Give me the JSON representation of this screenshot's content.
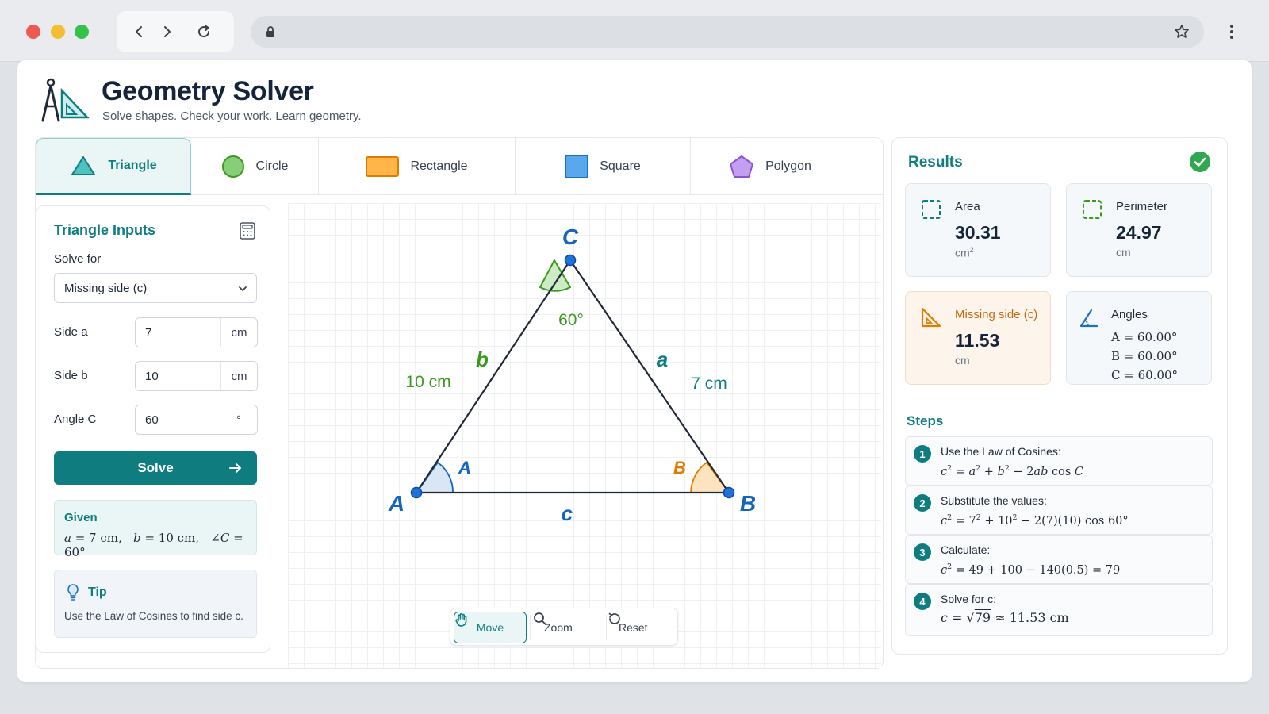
{
  "app": {
    "title": "Geometry Solver",
    "subtitle": "Solve shapes. Check your work. Learn geometry."
  },
  "tabs": [
    {
      "label": "Triangle",
      "icon": "triangle-icon",
      "active": true
    },
    {
      "label": "Circle",
      "icon": "circle-icon",
      "active": false
    },
    {
      "label": "Rectangle",
      "icon": "rectangle-icon",
      "active": false
    },
    {
      "label": "Square",
      "icon": "square-icon",
      "active": false
    },
    {
      "label": "Polygon",
      "icon": "pentagon-icon",
      "active": false
    }
  ],
  "inputs": {
    "title": "Triangle Inputs",
    "solve_for_label": "Solve for",
    "solve_for_value": "Missing side (c)",
    "side_a": {
      "label": "Side a",
      "value": "7",
      "unit": "cm"
    },
    "side_b": {
      "label": "Side b",
      "value": "10",
      "unit": "cm"
    },
    "angle_c": {
      "label": "Angle C",
      "value": "60",
      "unit": "°"
    },
    "solve_button": "Solve",
    "given_title": "Given",
    "tip_title": "Tip",
    "tip_text": "Use the Law of Cosines to find side c."
  },
  "diagram": {
    "vertex_a": "A",
    "vertex_b": "B",
    "vertex_c": "C",
    "side_a_name": "a",
    "side_b_name": "b",
    "side_c_name": "c",
    "side_a_length": "7 cm",
    "side_b_length": "10 cm",
    "angle_c_value": "60°",
    "angle_a_name": "A",
    "angle_b_name": "B"
  },
  "toolbar": {
    "move": "Move",
    "zoom": "Zoom",
    "reset": "Reset"
  },
  "results": {
    "title": "Results",
    "area": {
      "label": "Area",
      "value": "30.31",
      "unit": "cm"
    },
    "perimeter": {
      "label": "Perimeter",
      "value": "24.97",
      "unit": "cm"
    },
    "missing_side": {
      "label": "Missing side (c)",
      "value": "11.53",
      "unit": "cm"
    },
    "angles": {
      "label": "Angles",
      "a": "A = 60.00°",
      "b": "B = 60.00°",
      "c": "C = 60.00°"
    }
  },
  "steps": {
    "title": "Steps",
    "items": [
      {
        "num": "1",
        "label": "Use the Law of Cosines:"
      },
      {
        "num": "2",
        "label": "Substitute the values:"
      },
      {
        "num": "3",
        "label": "Calculate:"
      },
      {
        "num": "4",
        "label": "Solve for c:"
      }
    ]
  },
  "colors": {
    "accent": "#0f7d7f",
    "side_b_green": "#3a9a1e",
    "side_a_teal": "#0f7d7f",
    "vertex_blue": "#1565c0",
    "angle_b_orange": "#e07b00"
  }
}
